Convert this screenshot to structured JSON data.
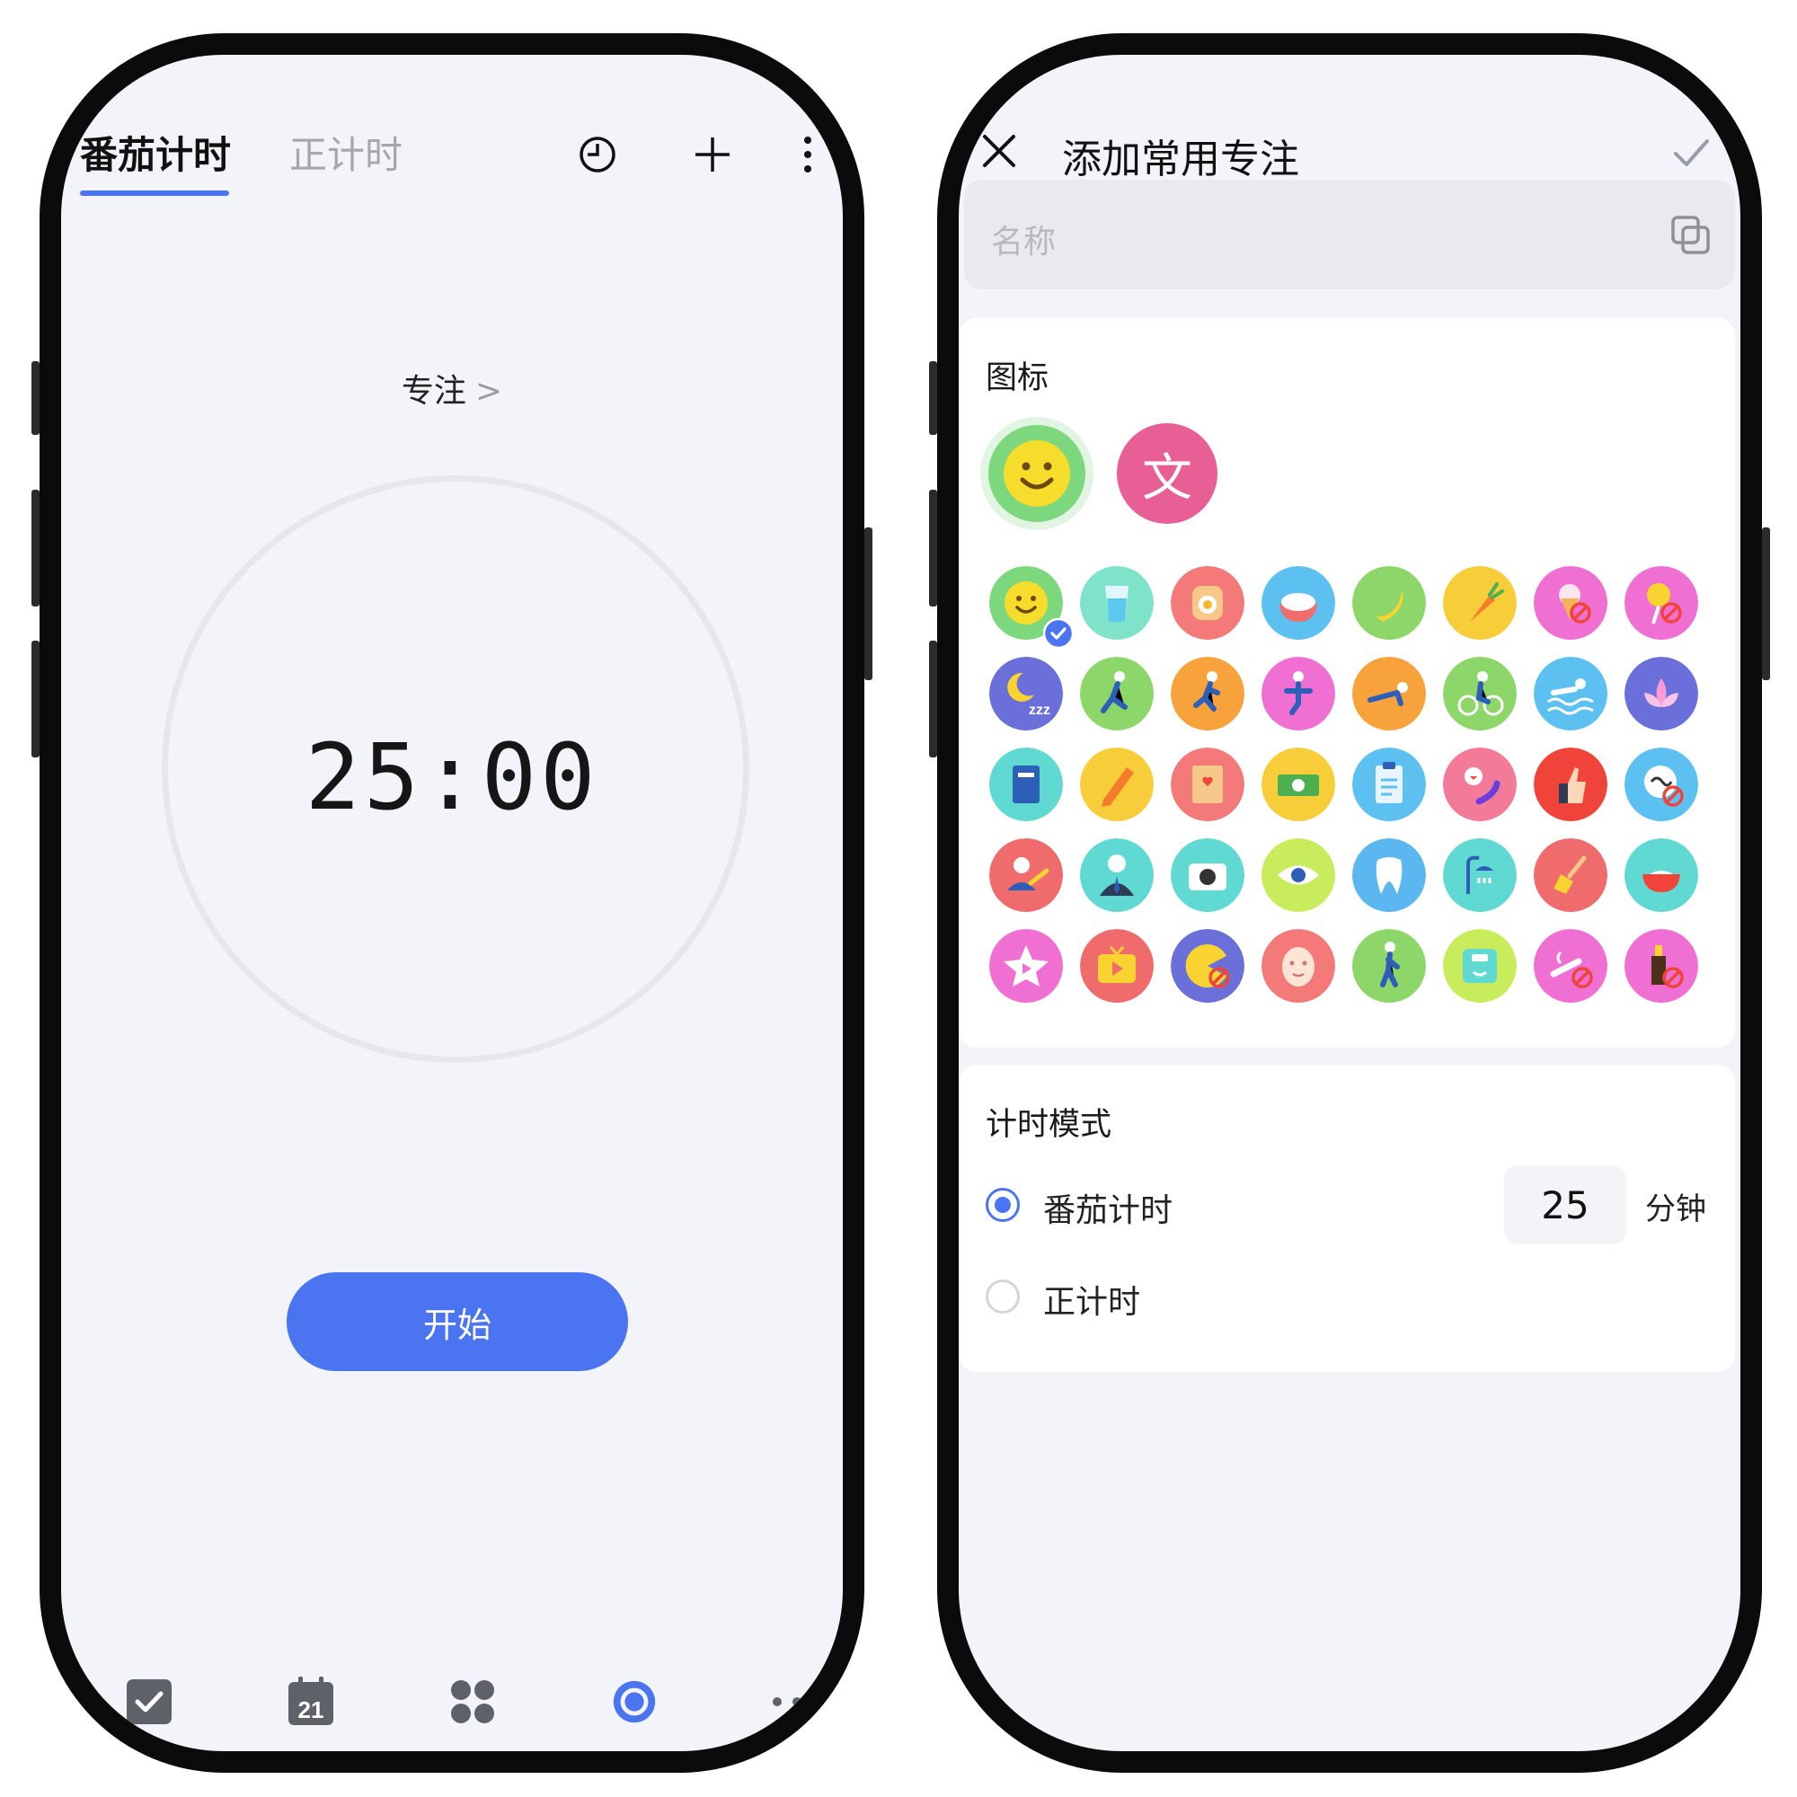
{
  "left_phone": {
    "tabs": [
      {
        "label": "番茄计时",
        "active": true
      },
      {
        "label": "正计时",
        "active": false
      }
    ],
    "toolbar_icons": [
      "stats-clock-icon",
      "plus-icon",
      "more-vertical-icon"
    ],
    "focus_label": "专注",
    "focus_chevron": ">",
    "timer": "25:00",
    "start_label": "开始",
    "bottom_nav": [
      {
        "icon": "task-check-icon",
        "active": false
      },
      {
        "icon": "calendar-icon",
        "label": "21",
        "active": false
      },
      {
        "icon": "apps-grid-icon",
        "active": false
      },
      {
        "icon": "focus-ring-icon",
        "active": true
      },
      {
        "icon": "more-horizontal-icon",
        "active": false
      }
    ],
    "colors": {
      "accent": "#4B74F1",
      "inactive_tab": "#A5A7AD",
      "nav_icon": "#5E6167"
    }
  },
  "right_phone": {
    "header": {
      "title": "添加常用专注",
      "close_icon": "close-icon",
      "confirm_icon": "check-icon"
    },
    "name_field": {
      "placeholder": "名称",
      "value": "",
      "trailing_icon": "copy-icon"
    },
    "icon_section": {
      "title": "图标",
      "type_options": [
        {
          "icon": "smiley-icon",
          "selected": true
        },
        {
          "text": "文",
          "selected": false
        }
      ],
      "grid": [
        [
          "smiley-icon",
          "water-glass-icon",
          "toast-egg-icon",
          "rice-bowl-icon",
          "banana-icon",
          "carrot-icon",
          "no-ice-cream-icon",
          "no-candy-icon"
        ],
        [
          "sleep-icon",
          "stretch-icon",
          "running-icon",
          "yoga-icon",
          "plank-icon",
          "cycling-icon",
          "swimming-icon",
          "lotus-icon"
        ],
        [
          "book-icon",
          "pencil-icon",
          "notebook-icon",
          "money-icon",
          "clipboard-icon",
          "phone-call-icon",
          "thumbs-up-icon",
          "no-swearing-icon"
        ],
        [
          "user-arrow-icon",
          "businessman-icon",
          "camera-icon",
          "eye-icon",
          "tooth-icon",
          "shower-icon",
          "broom-icon",
          "bowl-icon"
        ],
        [
          "star-play-icon",
          "tv-icon",
          "no-pacman-icon",
          "face-mask-icon",
          "walking-icon",
          "scale-icon",
          "no-smoking-icon",
          "no-alcohol-icon"
        ]
      ],
      "selected_grid_icon": "smiley-icon"
    },
    "mode_section": {
      "title": "计时模式",
      "options": [
        {
          "label": "番茄计时",
          "selected": true,
          "minutes": "25",
          "unit": "分钟"
        },
        {
          "label": "正计时",
          "selected": false
        }
      ]
    }
  }
}
